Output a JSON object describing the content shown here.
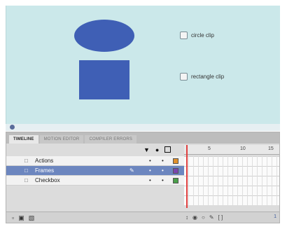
{
  "stage": {
    "checkbox1_label": "circle clip",
    "checkbox2_label": "rectangle clip",
    "shape_color": "#3f5fb5"
  },
  "timeline": {
    "tabs": [
      "TIMELINE",
      "MOTION EDITOR",
      "COMPILER ERRORS"
    ],
    "header_icons": [
      "eye-icon",
      "lock-icon",
      "outline-icon"
    ],
    "ruler_numbers": [
      "5",
      "10",
      "15"
    ],
    "layers": [
      {
        "name": "Actions",
        "color": "#e0902a"
      },
      {
        "name": "Frames",
        "color": "#7a44b0"
      },
      {
        "name": "Checkbox",
        "color": "#4aa04a"
      }
    ],
    "frame_number": "1"
  }
}
